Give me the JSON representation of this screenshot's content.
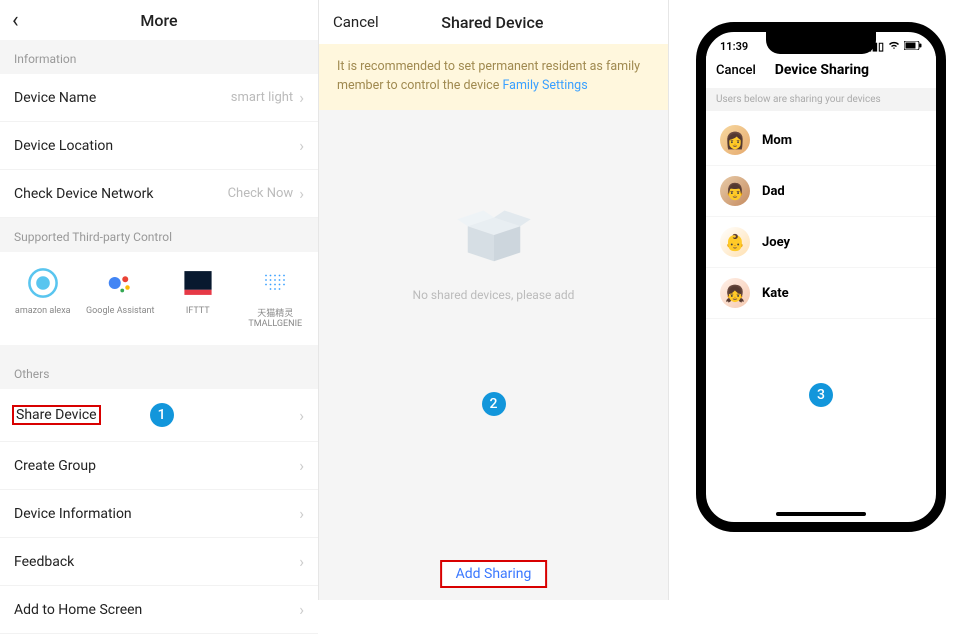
{
  "panel1": {
    "title": "More",
    "section_info_label": "Information",
    "rows_info": [
      {
        "label": "Device Name",
        "value": "smart light"
      },
      {
        "label": "Device Location",
        "value": ""
      },
      {
        "label": "Check Device Network",
        "value": "Check Now"
      }
    ],
    "section_third_label": "Supported Third-party Control",
    "integrations": [
      {
        "name": "amazon alexa"
      },
      {
        "name": "Google Assistant"
      },
      {
        "name": "IFTTT"
      },
      {
        "name": "天猫精灵\nTMALLGENIE"
      }
    ],
    "section_others_label": "Others",
    "rows_others": [
      {
        "label": "Share Device",
        "highlight": true
      },
      {
        "label": "Create Group"
      },
      {
        "label": "Device Information"
      },
      {
        "label": "Feedback"
      },
      {
        "label": "Add to Home Screen"
      }
    ],
    "step_badge": "1"
  },
  "panel2": {
    "cancel_label": "Cancel",
    "title": "Shared Device",
    "banner_text": "It is recommended to set permanent resident as family member to control the device ",
    "banner_link": "Family Settings",
    "empty_text": "No shared devices, please add",
    "step_badge": "2",
    "add_sharing_label": "Add Sharing"
  },
  "panel3": {
    "status_time": "11:39",
    "cancel_label": "Cancel",
    "title": "Device Sharing",
    "subheader": "Users below are sharing your devices",
    "members": [
      {
        "name": "Mom"
      },
      {
        "name": "Dad"
      },
      {
        "name": "Joey"
      },
      {
        "name": "Kate"
      }
    ],
    "step_badge": "3"
  }
}
